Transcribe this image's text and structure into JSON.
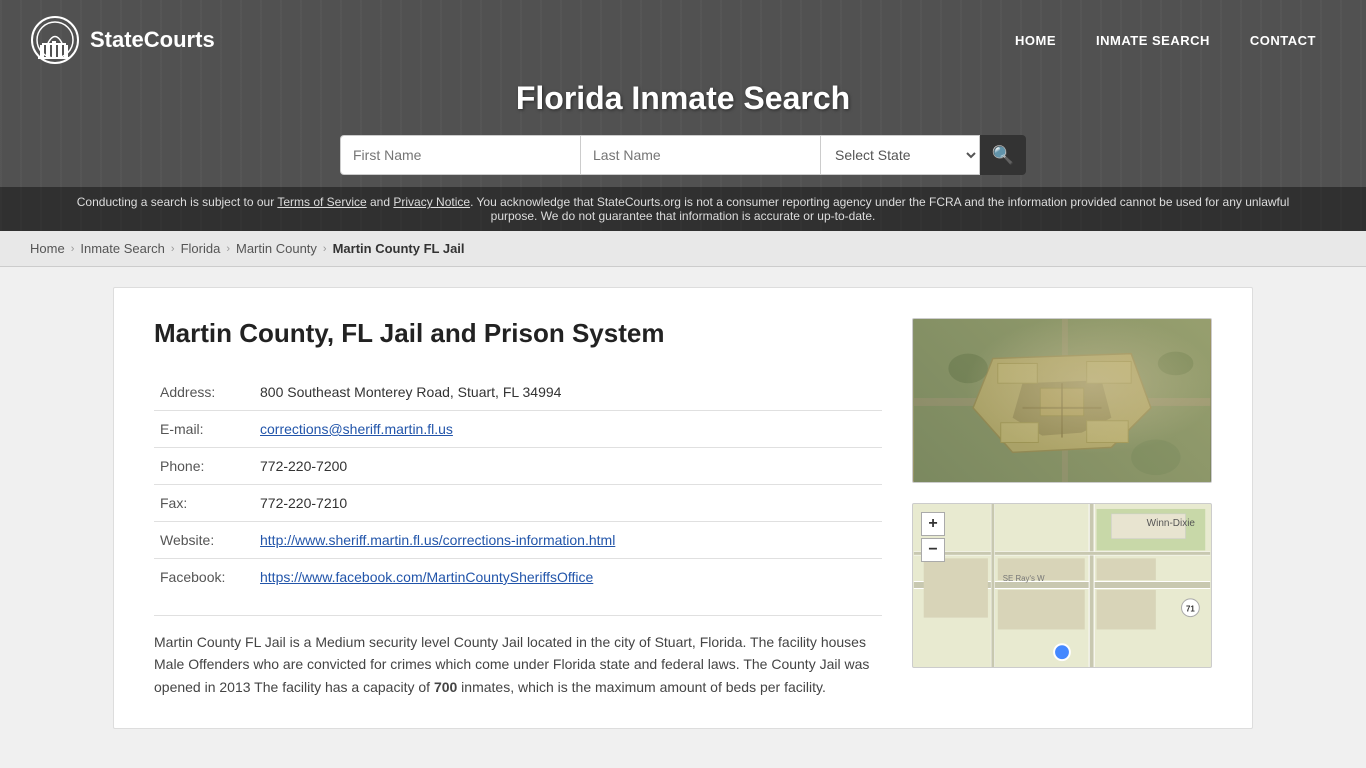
{
  "header": {
    "logo_text": "StateCourts",
    "title": "Florida Inmate Search",
    "nav": [
      {
        "label": "HOME",
        "href": "#"
      },
      {
        "label": "INMATE SEARCH",
        "href": "#"
      },
      {
        "label": "CONTACT",
        "href": "#"
      }
    ],
    "search": {
      "first_name_placeholder": "First Name",
      "last_name_placeholder": "Last Name",
      "state_default": "Select State",
      "search_icon": "🔍"
    },
    "disclaimer": "Conducting a search is subject to our Terms of Service and Privacy Notice. You acknowledge that StateCourts.org is not a consumer reporting agency under the FCRA and the information provided cannot be used for any unlawful purpose. We do not guarantee that information is accurate or up-to-date."
  },
  "breadcrumb": {
    "items": [
      {
        "label": "Home",
        "href": "#"
      },
      {
        "label": "Inmate Search",
        "href": "#"
      },
      {
        "label": "Florida",
        "href": "#"
      },
      {
        "label": "Martin County",
        "href": "#"
      },
      {
        "label": "Martin County FL Jail",
        "current": true
      }
    ]
  },
  "facility": {
    "title": "Martin County, FL Jail and Prison System",
    "fields": [
      {
        "label": "Address:",
        "value": "800 Southeast Monterey Road, Stuart, FL 34994",
        "type": "text"
      },
      {
        "label": "E-mail:",
        "value": "corrections@sheriff.martin.fl.us",
        "type": "link"
      },
      {
        "label": "Phone:",
        "value": "772-220-7200",
        "type": "text"
      },
      {
        "label": "Fax:",
        "value": "772-220-7210",
        "type": "text"
      },
      {
        "label": "Website:",
        "value": "http://www.sheriff.martin.fl.us/corrections-information.html",
        "type": "link"
      },
      {
        "label": "Facebook:",
        "value": "https://www.facebook.com/MartinCountySheriffsOffice",
        "type": "link"
      }
    ],
    "description": "Martin County FL Jail is a Medium security level County Jail located in the city of Stuart, Florida. The facility houses Male Offenders who are convicted for crimes which come under Florida state and federal laws. The County Jail was opened in 2013 The facility has a capacity of 700 inmates, which is the maximum amount of beds per facility.",
    "capacity_bold": "700",
    "map_zoom_in": "+",
    "map_zoom_out": "−"
  }
}
